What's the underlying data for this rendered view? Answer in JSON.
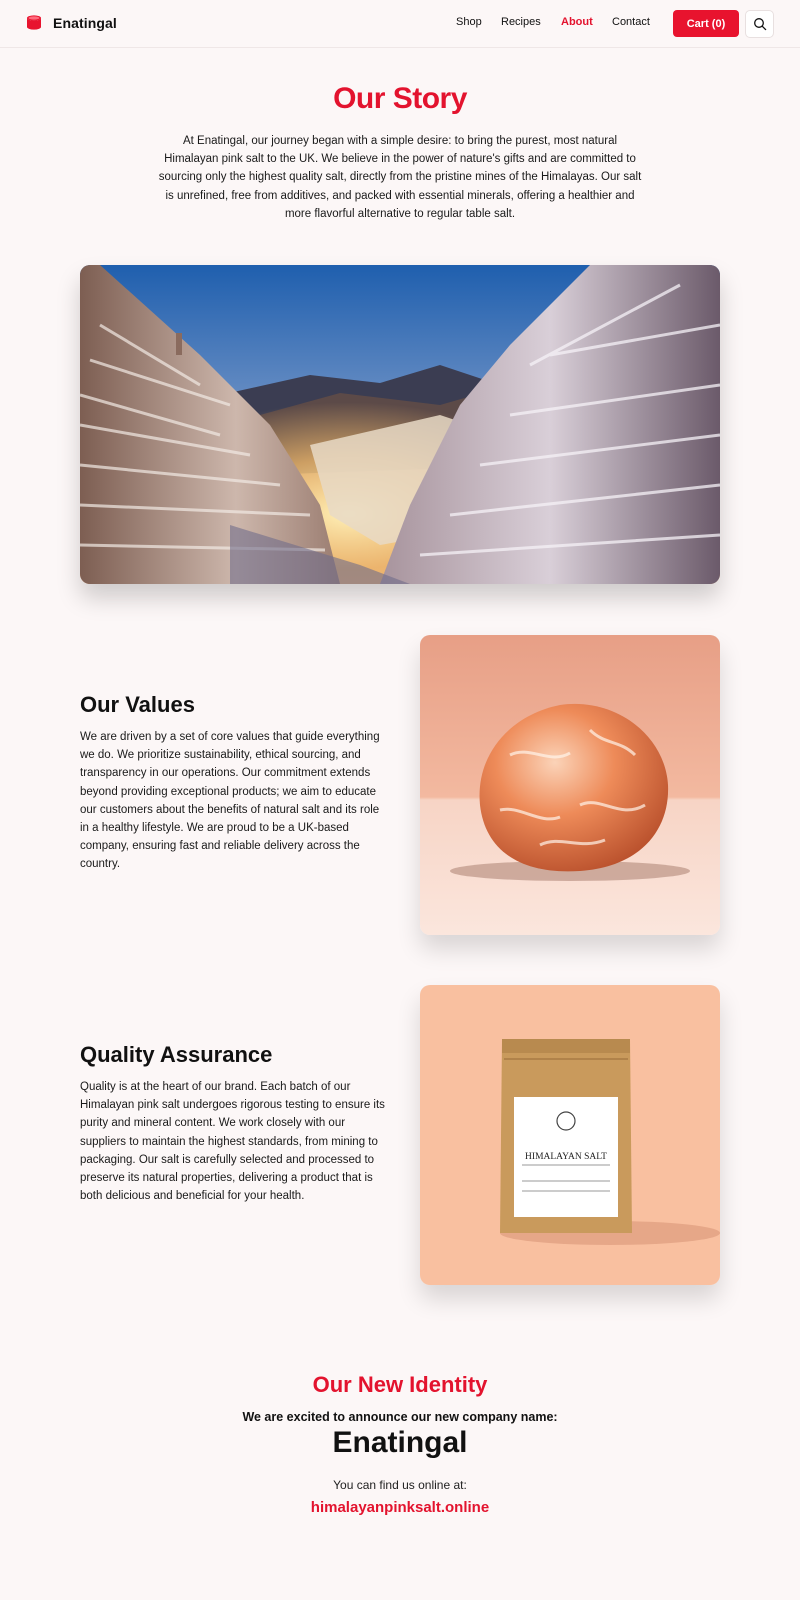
{
  "brand": {
    "name": "Enatingal",
    "accent": "#e8132e"
  },
  "nav": {
    "shop": "Shop",
    "recipes": "Recipes",
    "about": "About",
    "contact": "Contact"
  },
  "header": {
    "cart_label": "Cart (0)"
  },
  "story": {
    "title": "Our Story",
    "text": "At Enatingal, our journey began with a simple desire: to bring the purest, most natural Himalayan pink salt to the UK. We believe in the power of nature's gifts and are committed to sourcing only the highest quality salt, directly from the pristine mines of the Himalayas. Our salt is unrefined, free from additives, and packed with essential minerals, offering a healthier and more flavorful alternative to regular table salt."
  },
  "values": {
    "title": "Our Values",
    "text": "We are driven by a set of core values that guide everything we do. We prioritize sustainability, ethical sourcing, and transparency in our operations. Our commitment extends beyond providing exceptional products; we aim to educate our customers about the benefits of natural salt and its role in a healthy lifestyle. We are proud to be a UK-based company, ensuring fast and reliable delivery across the country."
  },
  "quality": {
    "title": "Quality Assurance",
    "text": "Quality is at the heart of our brand. Each batch of our Himalayan pink salt undergoes rigorous testing to ensure its purity and mineral content. We work closely with our suppliers to maintain the highest standards, from mining to packaging. Our salt is carefully selected and processed to preserve its natural properties, delivering a product that is both delicious and beneficial for your health."
  },
  "product_label": {
    "name": "HIMALAYAN SALT"
  },
  "identity": {
    "title": "Our New Identity",
    "announce": "We are excited to announce our new company name:",
    "name": "Enatingal",
    "find": "You can find us online at:",
    "url": "himalayanpinksalt.online"
  }
}
